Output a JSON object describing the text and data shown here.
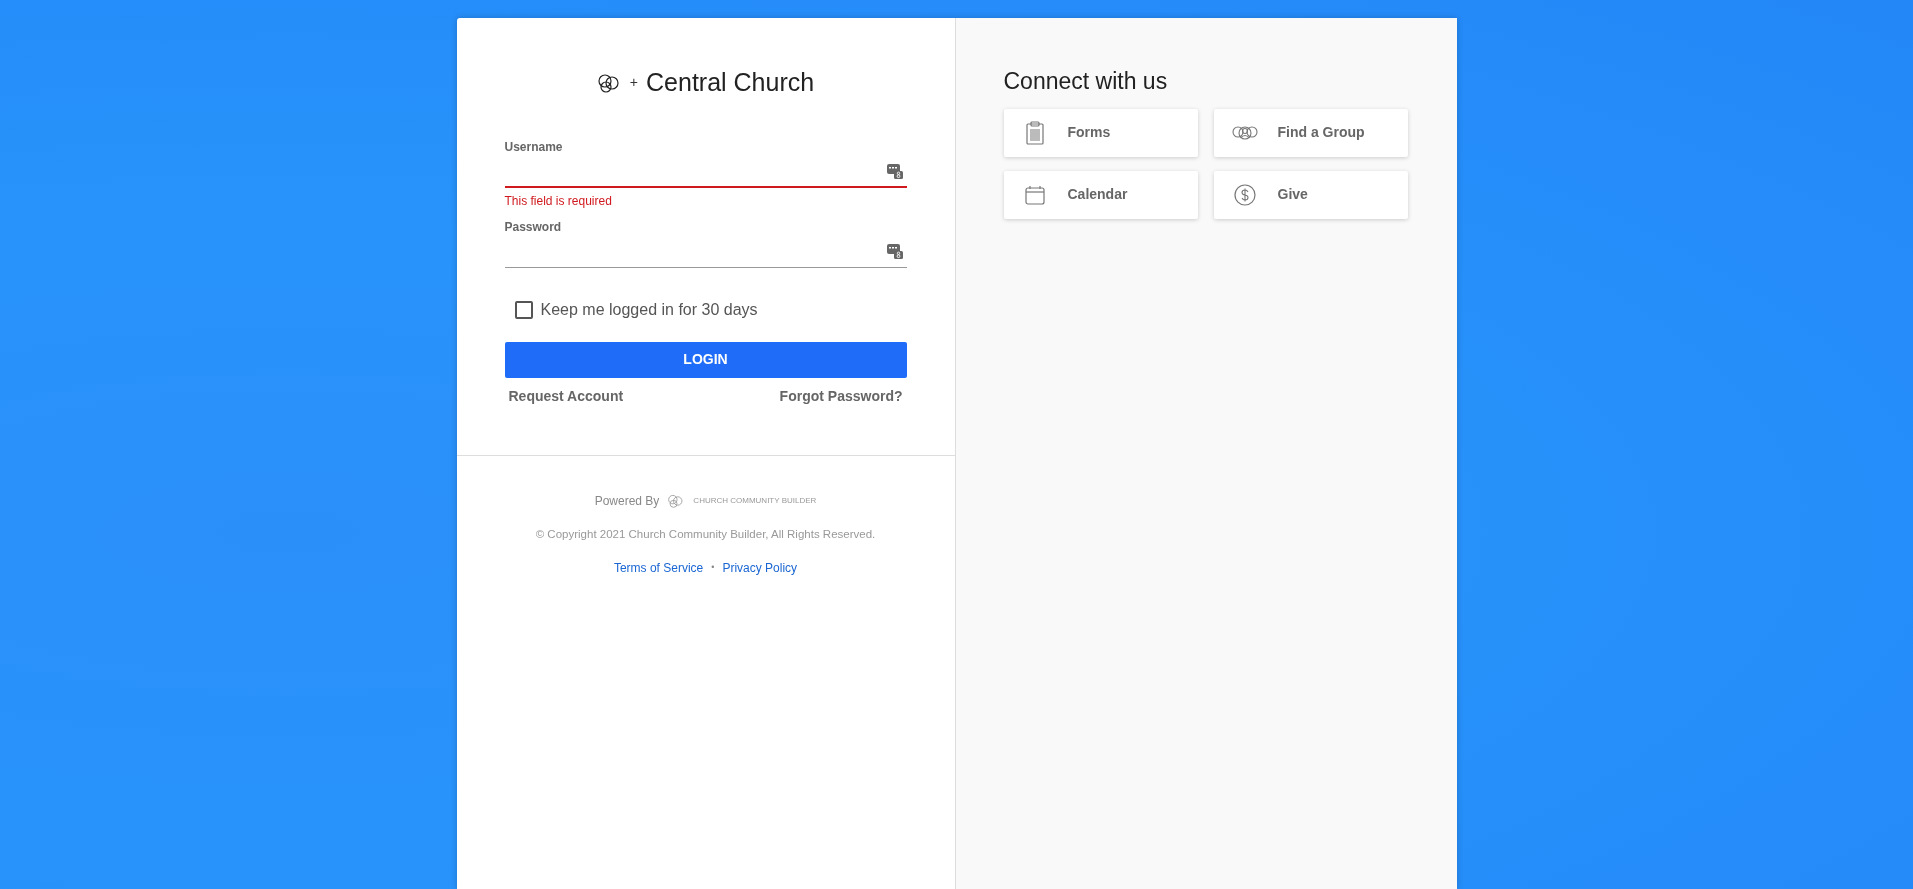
{
  "brand": {
    "plus": "+",
    "name": "Central Church"
  },
  "form": {
    "fields": [
      {
        "label": "Username",
        "error": "This field is required",
        "invalid": true
      },
      {
        "label": "Password",
        "invalid": false
      }
    ],
    "remember": {
      "label": "Keep me logged in for 30 days",
      "checked": false
    },
    "login_button": "LOGIN",
    "links": [
      "Request Account",
      "Forgot Password?"
    ]
  },
  "footer": {
    "powered_by": "Powered By",
    "builder": "CHURCH COMMUNITY BUILDER",
    "copyright": "© Copyright 2021 Church Community Builder, All Rights Reserved.",
    "links": [
      "Terms of Service",
      "Privacy Policy"
    ],
    "separator": "•"
  },
  "connect": {
    "title": "Connect with us",
    "tiles": [
      {
        "label": "Forms",
        "kind": "forms"
      },
      {
        "label": "Find a Group",
        "kind": "group"
      },
      {
        "label": "Calendar",
        "kind": "calendar"
      },
      {
        "label": "Give",
        "kind": "give"
      }
    ]
  }
}
